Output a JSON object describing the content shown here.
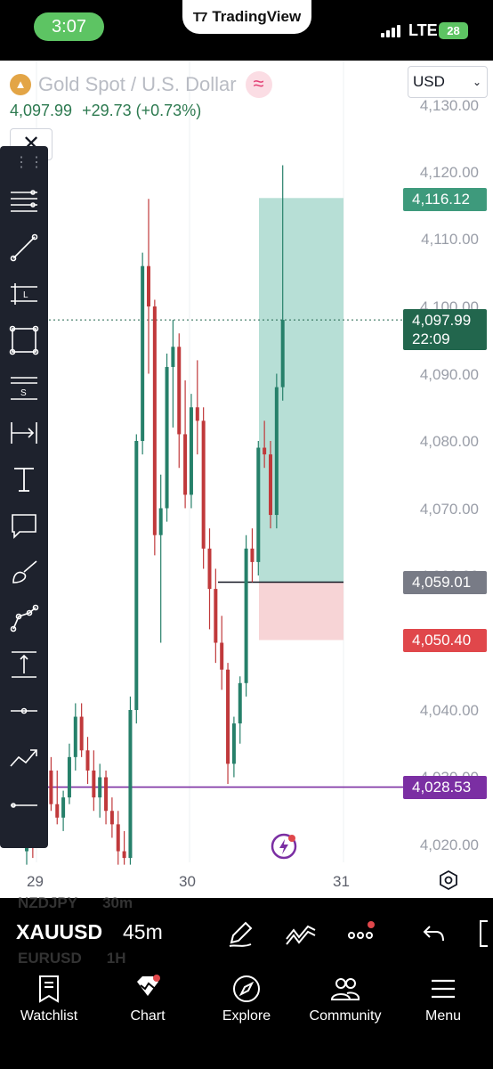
{
  "status_bar": {
    "time": "3:07",
    "app_pill": "TradingView",
    "network": "LTE",
    "battery": "28"
  },
  "chart": {
    "symbol_name": "Gold Spot / U.S. Dollar",
    "last_price_text": "4,097.99",
    "change_text": "+29.73 (+0.73%)",
    "currency": "USD",
    "y_axis_labels": [
      "4,130.00",
      "4,120.00",
      "4,110.00",
      "4,100.00",
      "4,090.00",
      "4,080.00",
      "4,070.00",
      "4,060.00",
      "4,040.00",
      "4,030.00",
      "4,020.00"
    ],
    "x_axis_labels": [
      "29",
      "30",
      "31"
    ],
    "price_tags": {
      "target": "4,116.12",
      "current": "4,097.99",
      "countdown": "22:09",
      "entry": "4,059.01",
      "stop": "4,050.40",
      "horizontal_line": "4,028.53"
    },
    "colors": {
      "up": "#26806a",
      "down": "#c0393b",
      "target_zone": "#b7dfd6",
      "stop_zone": "#f7d4d6",
      "hline": "#7b2fa3",
      "current_tag": "#22664d"
    }
  },
  "chart_data": {
    "type": "candlestick",
    "symbol": "XAUUSD",
    "timeframe": "45m",
    "ylim": [
      4017,
      4131
    ],
    "candles": [
      {
        "o": 4019,
        "h": 4027,
        "l": 4017,
        "c": 4022
      },
      {
        "o": 4022,
        "h": 4026,
        "l": 4018,
        "c": 4020
      },
      {
        "o": 4022,
        "h": 4030,
        "l": 4020,
        "c": 4027
      },
      {
        "o": 4027,
        "h": 4034,
        "l": 4025,
        "c": 4031
      },
      {
        "o": 4031,
        "h": 4033,
        "l": 4025,
        "c": 4026
      },
      {
        "o": 4026,
        "h": 4031,
        "l": 4023,
        "c": 4024
      },
      {
        "o": 4024,
        "h": 4028,
        "l": 4022,
        "c": 4027
      },
      {
        "o": 4027,
        "h": 4035,
        "l": 4026,
        "c": 4033
      },
      {
        "o": 4033,
        "h": 4041,
        "l": 4031,
        "c": 4039
      },
      {
        "o": 4039,
        "h": 4041,
        "l": 4033,
        "c": 4034
      },
      {
        "o": 4034,
        "h": 4036,
        "l": 4029,
        "c": 4031
      },
      {
        "o": 4031,
        "h": 4034,
        "l": 4025,
        "c": 4027
      },
      {
        "o": 4027,
        "h": 4032,
        "l": 4024,
        "c": 4030
      },
      {
        "o": 4030,
        "h": 4031,
        "l": 4023,
        "c": 4025
      },
      {
        "o": 4025,
        "h": 4027,
        "l": 4021,
        "c": 4023
      },
      {
        "o": 4023,
        "h": 4025,
        "l": 4017,
        "c": 4019
      },
      {
        "o": 4019,
        "h": 4022,
        "l": 4017,
        "c": 4018
      },
      {
        "o": 4018,
        "h": 4042,
        "l": 4017,
        "c": 4040
      },
      {
        "o": 4040,
        "h": 4081,
        "l": 4038,
        "c": 4080
      },
      {
        "o": 4080,
        "h": 4108,
        "l": 4078,
        "c": 4106
      },
      {
        "o": 4106,
        "h": 4116,
        "l": 4090,
        "c": 4100
      },
      {
        "o": 4100,
        "h": 4101,
        "l": 4063,
        "c": 4066
      },
      {
        "o": 4066,
        "h": 4075,
        "l": 4050,
        "c": 4070
      },
      {
        "o": 4070,
        "h": 4093,
        "l": 4068,
        "c": 4091
      },
      {
        "o": 4091,
        "h": 4098,
        "l": 4082,
        "c": 4094
      },
      {
        "o": 4094,
        "h": 4096,
        "l": 4076,
        "c": 4081
      },
      {
        "o": 4081,
        "h": 4089,
        "l": 4070,
        "c": 4072
      },
      {
        "o": 4072,
        "h": 4087,
        "l": 4070,
        "c": 4085
      },
      {
        "o": 4085,
        "h": 4092,
        "l": 4078,
        "c": 4083
      },
      {
        "o": 4083,
        "h": 4085,
        "l": 4061,
        "c": 4064
      },
      {
        "o": 4064,
        "h": 4067,
        "l": 4052,
        "c": 4058
      },
      {
        "o": 4058,
        "h": 4061,
        "l": 4047,
        "c": 4050
      },
      {
        "o": 4050,
        "h": 4054,
        "l": 4043,
        "c": 4046
      },
      {
        "o": 4046,
        "h": 4047,
        "l": 4029,
        "c": 4032
      },
      {
        "o": 4032,
        "h": 4039,
        "l": 4030,
        "c": 4038
      },
      {
        "o": 4038,
        "h": 4045,
        "l": 4035,
        "c": 4044
      },
      {
        "o": 4044,
        "h": 4066,
        "l": 4042,
        "c": 4064
      },
      {
        "o": 4064,
        "h": 4067,
        "l": 4059,
        "c": 4062
      },
      {
        "o": 4062,
        "h": 4080,
        "l": 4060,
        "c": 4079
      },
      {
        "o": 4079,
        "h": 4083,
        "l": 4076,
        "c": 4078
      },
      {
        "o": 4078,
        "h": 4080,
        "l": 4067,
        "c": 4069
      },
      {
        "o": 4069,
        "h": 4090,
        "l": 4067,
        "c": 4088
      },
      {
        "o": 4088,
        "h": 4121,
        "l": 4086,
        "c": 4098
      }
    ],
    "target": 4116.12,
    "entry": 4059.01,
    "stop": 4050.4,
    "current": 4097.99,
    "horizontal_line": 4028.53
  },
  "toolbar": {
    "tools": [
      "trend-lines-icon",
      "line-icon",
      "price-label-icon",
      "rectangle-icon",
      "pattern-icon",
      "measure-icon",
      "text-icon",
      "comment-icon",
      "brush-icon",
      "path-icon",
      "vertical-range-icon",
      "horizontal-ray-icon",
      "trend-icon",
      "horizontal-line-icon"
    ]
  },
  "bottom_bar": {
    "ghost_top_symbol": "NZDJPY",
    "ghost_top_tf": "30m",
    "symbol": "XAUUSD",
    "timeframe": "45m",
    "ghost_bottom_symbol": "EURUSD",
    "ghost_bottom_tf": "1H"
  },
  "tabs": [
    {
      "label": "Watchlist",
      "icon": "watchlist-icon"
    },
    {
      "label": "Chart",
      "icon": "chart-icon"
    },
    {
      "label": "Explore",
      "icon": "compass-icon"
    },
    {
      "label": "Community",
      "icon": "community-icon"
    },
    {
      "label": "Menu",
      "icon": "menu-icon"
    }
  ]
}
